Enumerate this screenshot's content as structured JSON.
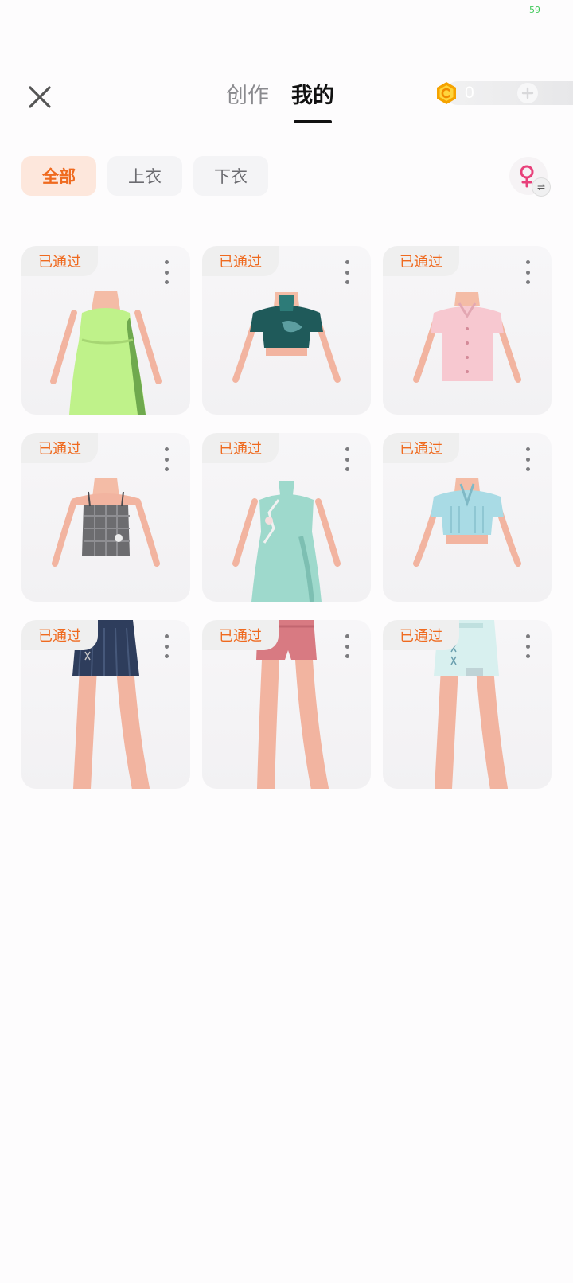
{
  "status": {
    "fps": "59"
  },
  "header": {
    "tabs": [
      {
        "label": "创作",
        "active": false
      },
      {
        "label": "我的",
        "active": true
      }
    ],
    "coins": {
      "value": "0"
    }
  },
  "filters": [
    {
      "label": "全部",
      "active": true
    },
    {
      "label": "上衣",
      "active": false
    },
    {
      "label": "下衣",
      "active": false
    }
  ],
  "gender_toggle": {
    "icon": "female-icon"
  },
  "items": [
    {
      "status": "已通过",
      "garment": "strapless-dress",
      "color": "#bff28a"
    },
    {
      "status": "已通过",
      "garment": "crop-shirt",
      "color": "#1f5a5a"
    },
    {
      "status": "已通过",
      "garment": "button-shirt",
      "color": "#f7c8d0"
    },
    {
      "status": "已通过",
      "garment": "plaid-camisole",
      "color": "#6c6c6f"
    },
    {
      "status": "已通过",
      "garment": "qipao-dress",
      "color": "#9ed9cc"
    },
    {
      "status": "已通过",
      "garment": "crop-shirt",
      "color": "#a9dbe5"
    },
    {
      "status": "已通过",
      "garment": "pleated-skirt",
      "color": "#2e3d5c"
    },
    {
      "status": "已通过",
      "garment": "shorts",
      "color": "#d87a82"
    },
    {
      "status": "已通过",
      "garment": "mini-skirt",
      "color": "#d8f0ef"
    }
  ]
}
